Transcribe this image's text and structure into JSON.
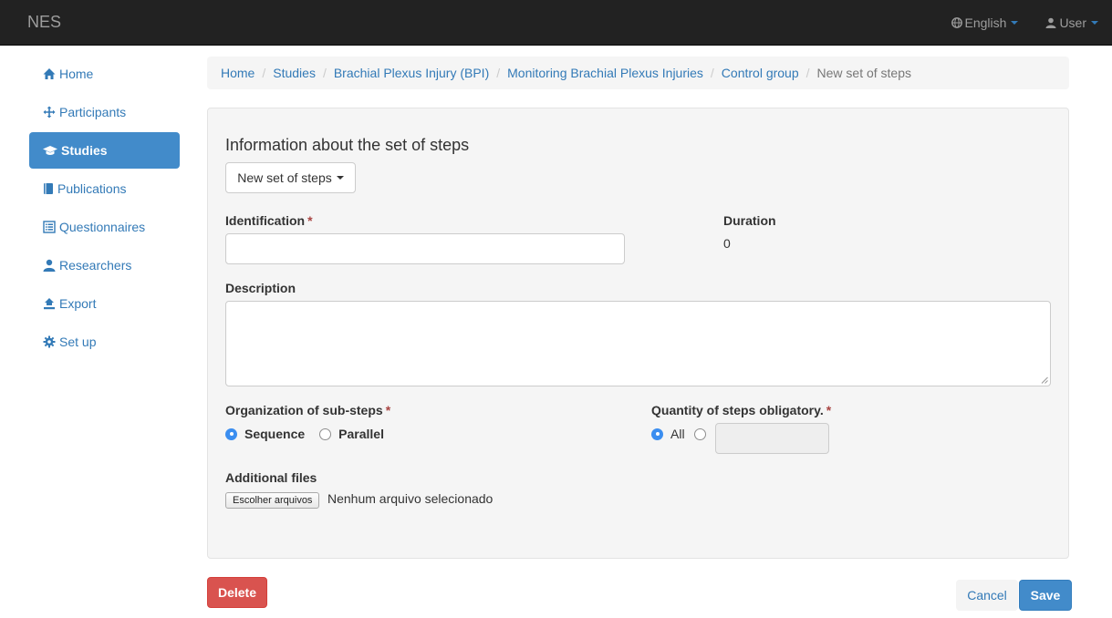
{
  "app": {
    "brand": "NES"
  },
  "navbar": {
    "language": {
      "label": "English",
      "icon": "globe-icon"
    },
    "user": {
      "label": "User",
      "icon": "user-icon"
    }
  },
  "sidebar": {
    "items": [
      {
        "label": "Home",
        "icon": "home-icon",
        "active": false
      },
      {
        "label": "Participants",
        "icon": "move-icon",
        "active": false
      },
      {
        "label": "Studies",
        "icon": "graduation-cap-icon",
        "active": true
      },
      {
        "label": "Publications",
        "icon": "book-icon",
        "active": false
      },
      {
        "label": "Questionnaires",
        "icon": "list-alt-icon",
        "active": false
      },
      {
        "label": "Researchers",
        "icon": "user-icon",
        "active": false
      },
      {
        "label": "Export",
        "icon": "export-icon",
        "active": false
      },
      {
        "label": "Set up",
        "icon": "cog-icon",
        "active": false
      }
    ]
  },
  "breadcrumb": {
    "items": [
      "Home",
      "Studies",
      "Brachial Plexus Injury (BPI)",
      "Monitoring Brachial Plexus Injuries",
      "Control group"
    ],
    "active": "New set of steps",
    "separator": "/"
  },
  "form": {
    "title": "Information about the set of steps",
    "dropdown_label": "New set of steps",
    "identification": {
      "label": "Identification",
      "value": "",
      "required_mark": "*"
    },
    "duration": {
      "label": "Duration",
      "value": "0"
    },
    "description": {
      "label": "Description",
      "value": ""
    },
    "organization": {
      "label": "Organization of sub-steps",
      "required_mark": "*",
      "options": [
        "Sequence",
        "Parallel"
      ],
      "selected": "Sequence"
    },
    "quantity": {
      "label": "Quantity of steps obligatory.",
      "required_mark": "*",
      "option_all": "All",
      "selected": "All",
      "number_value": ""
    },
    "files": {
      "label": "Additional files",
      "button_label": "Escolher arquivos",
      "status": "Nenhum arquivo selecionado"
    }
  },
  "actions": {
    "delete": "Delete",
    "cancel": "Cancel",
    "save": "Save"
  },
  "colors": {
    "navbar_bg": "#222222",
    "link": "#337ab7",
    "active_nav": "#428bca",
    "danger": "#d9534f",
    "required": "#a94442",
    "radio_checked": "#3b8ef0"
  }
}
